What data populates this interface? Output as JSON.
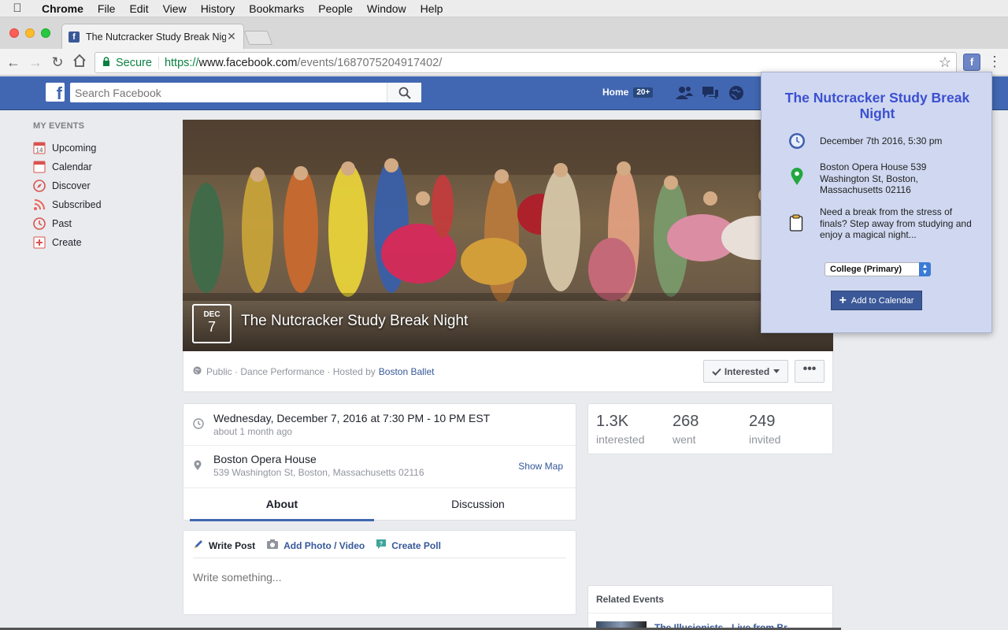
{
  "menubar": {
    "app": "Chrome",
    "items": [
      "File",
      "Edit",
      "View",
      "History",
      "Bookmarks",
      "People",
      "Window",
      "Help"
    ]
  },
  "browser": {
    "tab_title": "The Nutcracker Study Break Night",
    "address": {
      "secure_label": "Secure",
      "scheme": "https://",
      "host": "www.facebook.com",
      "path": "/events/1687075204917402/"
    }
  },
  "fb": {
    "search_placeholder": "Search Facebook",
    "home_label": "Home",
    "home_badge": "20+",
    "brand_color": "#4267b2"
  },
  "leftnav": {
    "header": "MY EVENTS",
    "items": [
      {
        "label": "Upcoming",
        "icon": "calendar-14-icon"
      },
      {
        "label": "Calendar",
        "icon": "calendar-icon"
      },
      {
        "label": "Discover",
        "icon": "compass-icon"
      },
      {
        "label": "Subscribed",
        "icon": "rss-icon"
      },
      {
        "label": "Past",
        "icon": "clock-icon"
      },
      {
        "label": "Create",
        "icon": "plus-box-icon"
      }
    ],
    "upcoming_day": "14"
  },
  "event": {
    "month": "DEC",
    "day": "7",
    "title": "The Nutcracker Study Break Night",
    "meta_prefix": "Public · Dance Performance · Hosted by",
    "host": "Boston Ballet",
    "interested_label": "Interested",
    "more_label": "•••",
    "datetime": "Wednesday, December 7, 2016 at 7:30 PM - 10 PM EST",
    "relative_time": "about 1 month ago",
    "venue": "Boston Opera House",
    "address": "539 Washington St, Boston, Massachusetts 02116",
    "show_map": "Show Map",
    "tabs": [
      "About",
      "Discussion"
    ]
  },
  "stats": [
    {
      "value": "1.3K",
      "label": "interested"
    },
    {
      "value": "268",
      "label": "went"
    },
    {
      "value": "249",
      "label": "invited"
    }
  ],
  "composer": {
    "write_post": "Write Post",
    "add_photo": "Add Photo / Video",
    "create_poll": "Create Poll",
    "placeholder": "Write something..."
  },
  "related": {
    "header": "Related Events",
    "first_title": "The Illusionists - Live from Br..."
  },
  "popup": {
    "title": "The Nutcracker Study Break Night",
    "datetime": "December 7th 2016, 5:30 pm",
    "location": "Boston Opera House 539 Washington St, Boston, Massachusetts 02116",
    "description": "Need a break from the stress of finals? Step away from studying and enjoy a magical night...",
    "calendar_selected": "College (Primary)",
    "add_label": "Add to Calendar",
    "accent_color": "#3c4fd0"
  }
}
